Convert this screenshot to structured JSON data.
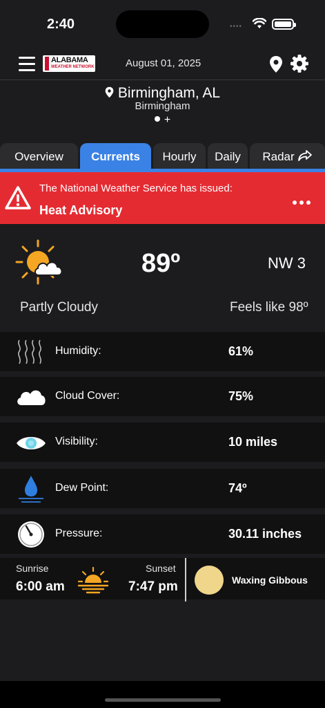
{
  "status": {
    "time": "2:40"
  },
  "header": {
    "logo_line1": "ALABAMA",
    "logo_line2": "WEATHER NETWORK",
    "date": "August 01, 2025"
  },
  "location": {
    "city": "Birmingham, AL",
    "subcity": "Birmingham",
    "add_label": "+"
  },
  "tabs": [
    {
      "label": "Overview"
    },
    {
      "label": "Currents"
    },
    {
      "label": "Hourly"
    },
    {
      "label": "Daily"
    },
    {
      "label": "Radar"
    }
  ],
  "active_tab": "Currents",
  "alert": {
    "line1": "The National Weather Service has issued:",
    "title": "Heat Advisory"
  },
  "current": {
    "icon": "partly-cloudy-icon",
    "temp": "89º",
    "wind": "NW 3",
    "condition": "Partly Cloudy",
    "feels_like": "Feels like 98º"
  },
  "details": [
    {
      "icon": "humidity-icon",
      "label": "Humidity:",
      "value": "61%"
    },
    {
      "icon": "cloud-icon",
      "label": "Cloud Cover:",
      "value": "75%"
    },
    {
      "icon": "eye-icon",
      "label": "Visibility:",
      "value": "10 miles"
    },
    {
      "icon": "dew-drop-icon",
      "label": "Dew Point:",
      "value": "74º"
    },
    {
      "icon": "pressure-gauge-icon",
      "label": "Pressure:",
      "value": "30.11 inches"
    }
  ],
  "sun": {
    "sunrise_label": "Sunrise",
    "sunrise": "6:00 am",
    "sunset_label": "Sunset",
    "sunset": "7:47 pm",
    "moon_phase": "Waxing Gibbous"
  },
  "colors": {
    "accent": "#3b82e6",
    "alert": "#e52b32",
    "sun": "#f5a623",
    "background": "#1c1c1e"
  }
}
